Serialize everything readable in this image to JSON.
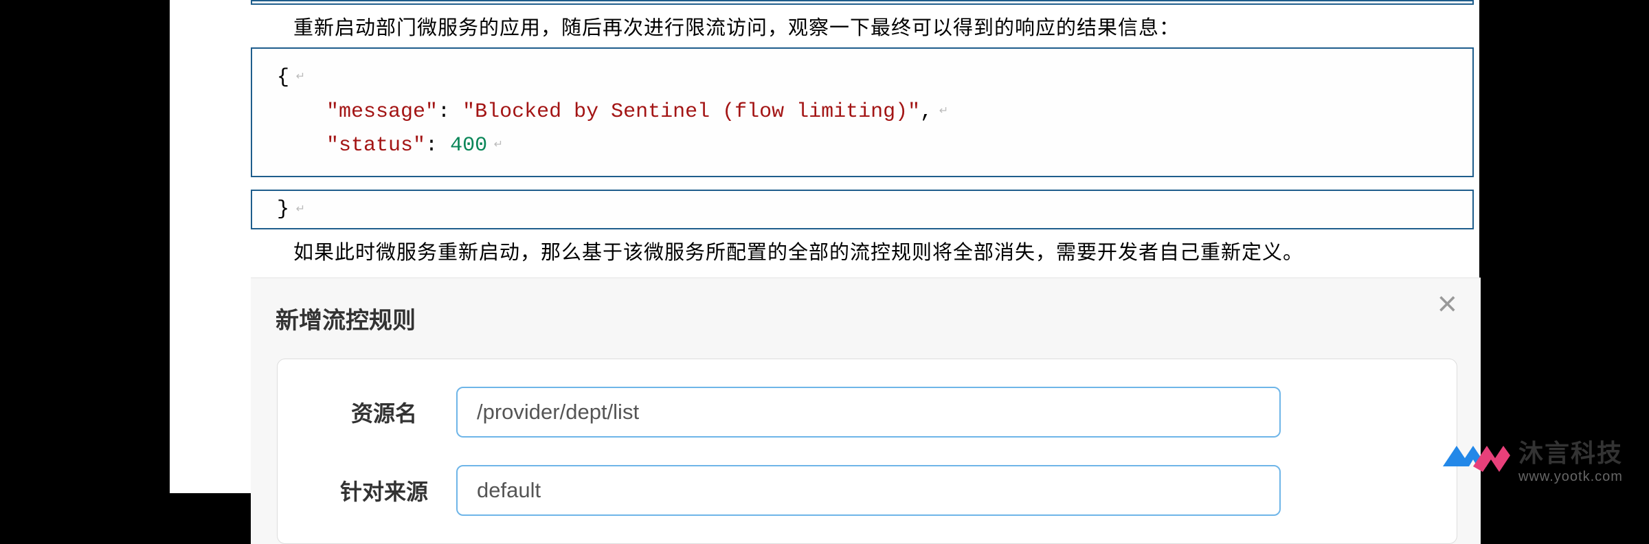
{
  "doc": {
    "intro_text": "重新启动部门微服务的应用，随后再次进行限流访问，观察一下最终可以得到的响应的结果信息：",
    "json_response": {
      "open_brace": "{",
      "message_key": "\"message\"",
      "colon1": ": ",
      "message_value": "\"Blocked by Sentinel (flow limiting)\"",
      "comma1": ",",
      "status_key": "\"status\"",
      "colon2": ": ",
      "status_value": "400",
      "close_brace": "}"
    },
    "note_text": "如果此时微服务重新启动，那么基于该微服务所配置的全部的流控规则将全部消失，需要开发者自己重新定义。"
  },
  "dialog": {
    "title": "新增流控规则",
    "close_symbol": "×",
    "fields": {
      "resource": {
        "label": "资源名",
        "value": "/provider/dept/list"
      },
      "source": {
        "label": "针对来源",
        "value": "default"
      }
    }
  },
  "watermark": {
    "brand": "沐言科技",
    "url": "www.yootk.com"
  }
}
